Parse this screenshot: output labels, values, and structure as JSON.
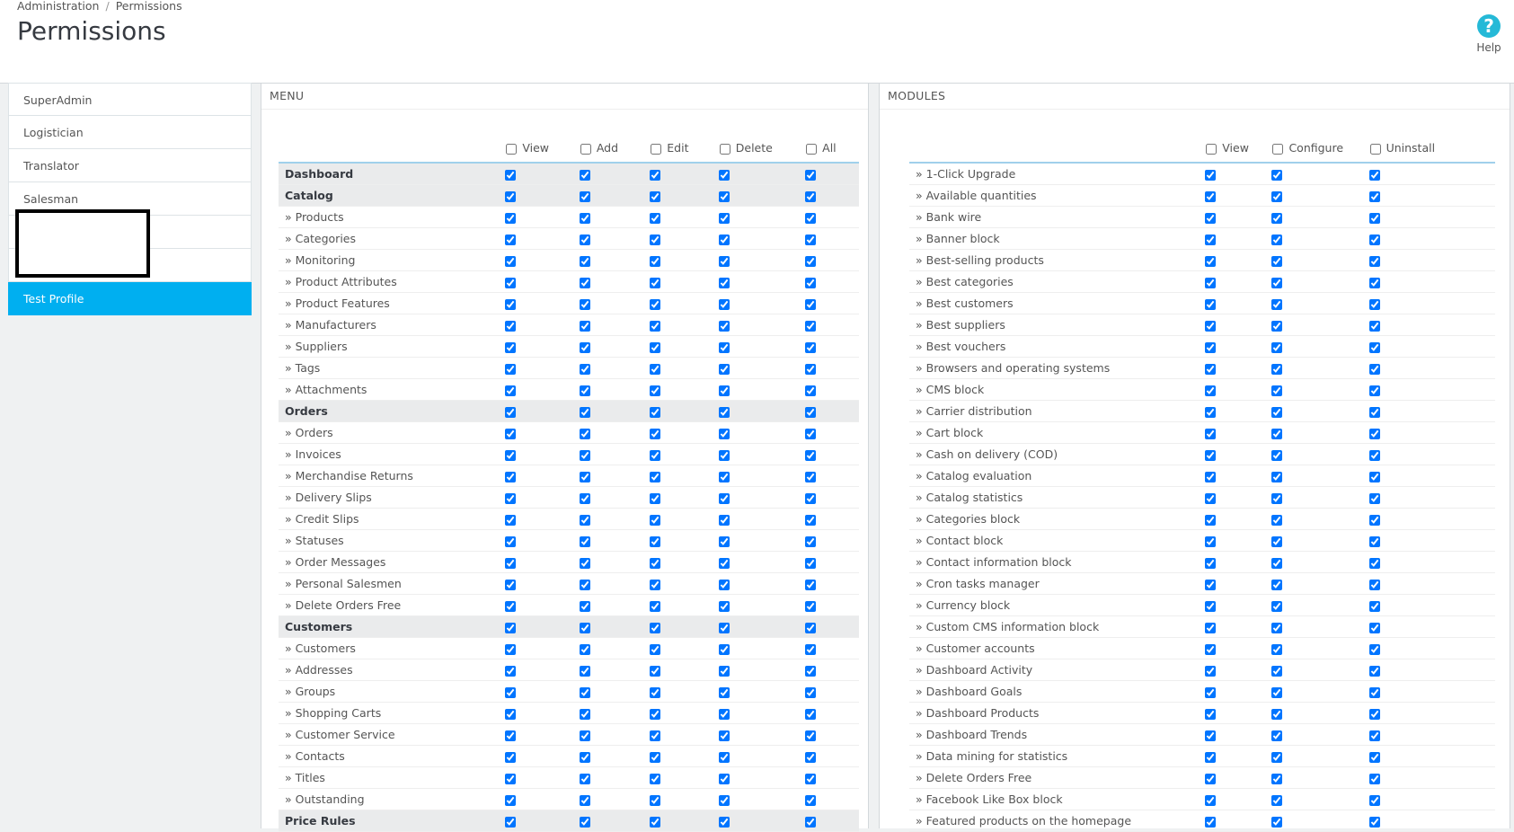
{
  "breadcrumb": {
    "root": "Administration",
    "current": "Permissions"
  },
  "title": "Permissions",
  "help_label": "Help",
  "profiles": [
    "SuperAdmin",
    "Logistician",
    "Translator",
    "Salesman",
    "",
    "",
    "Test Profile"
  ],
  "menu": {
    "heading": "MENU",
    "columns": [
      "View",
      "Add",
      "Edit",
      "Delete",
      "All"
    ],
    "rows": [
      {
        "label": "Dashboard",
        "parent": true
      },
      {
        "label": "Catalog",
        "parent": true
      },
      {
        "label": "» Products",
        "parent": false
      },
      {
        "label": "» Categories",
        "parent": false
      },
      {
        "label": "» Monitoring",
        "parent": false
      },
      {
        "label": "» Product Attributes",
        "parent": false
      },
      {
        "label": "» Product Features",
        "parent": false
      },
      {
        "label": "» Manufacturers",
        "parent": false
      },
      {
        "label": "» Suppliers",
        "parent": false
      },
      {
        "label": "» Tags",
        "parent": false
      },
      {
        "label": "» Attachments",
        "parent": false
      },
      {
        "label": "Orders",
        "parent": true
      },
      {
        "label": "» Orders",
        "parent": false
      },
      {
        "label": "» Invoices",
        "parent": false
      },
      {
        "label": "» Merchandise Returns",
        "parent": false
      },
      {
        "label": "» Delivery Slips",
        "parent": false
      },
      {
        "label": "» Credit Slips",
        "parent": false
      },
      {
        "label": "» Statuses",
        "parent": false
      },
      {
        "label": "» Order Messages",
        "parent": false
      },
      {
        "label": "» Personal Salesmen",
        "parent": false
      },
      {
        "label": "» Delete Orders Free",
        "parent": false
      },
      {
        "label": "Customers",
        "parent": true
      },
      {
        "label": "» Customers",
        "parent": false
      },
      {
        "label": "» Addresses",
        "parent": false
      },
      {
        "label": "» Groups",
        "parent": false
      },
      {
        "label": "» Shopping Carts",
        "parent": false
      },
      {
        "label": "» Customer Service",
        "parent": false
      },
      {
        "label": "» Contacts",
        "parent": false
      },
      {
        "label": "» Titles",
        "parent": false
      },
      {
        "label": "» Outstanding",
        "parent": false
      },
      {
        "label": "Price Rules",
        "parent": true
      }
    ]
  },
  "modules": {
    "heading": "MODULES",
    "columns": [
      "View",
      "Configure",
      "Uninstall"
    ],
    "rows": [
      "» 1-Click Upgrade",
      "» Available quantities",
      "» Bank wire",
      "» Banner block",
      "» Best-selling products",
      "» Best categories",
      "» Best customers",
      "» Best suppliers",
      "» Best vouchers",
      "» Browsers and operating systems",
      "» CMS block",
      "» Carrier distribution",
      "» Cart block",
      "» Cash on delivery (COD)",
      "» Catalog evaluation",
      "» Catalog statistics",
      "» Categories block",
      "» Contact block",
      "» Contact information block",
      "» Cron tasks manager",
      "» Currency block",
      "» Custom CMS information block",
      "» Customer accounts",
      "» Dashboard Activity",
      "» Dashboard Goals",
      "» Dashboard Products",
      "» Dashboard Trends",
      "» Data mining for statistics",
      "» Delete Orders Free",
      "» Facebook Like Box block",
      "» Featured products on the homepage"
    ]
  }
}
